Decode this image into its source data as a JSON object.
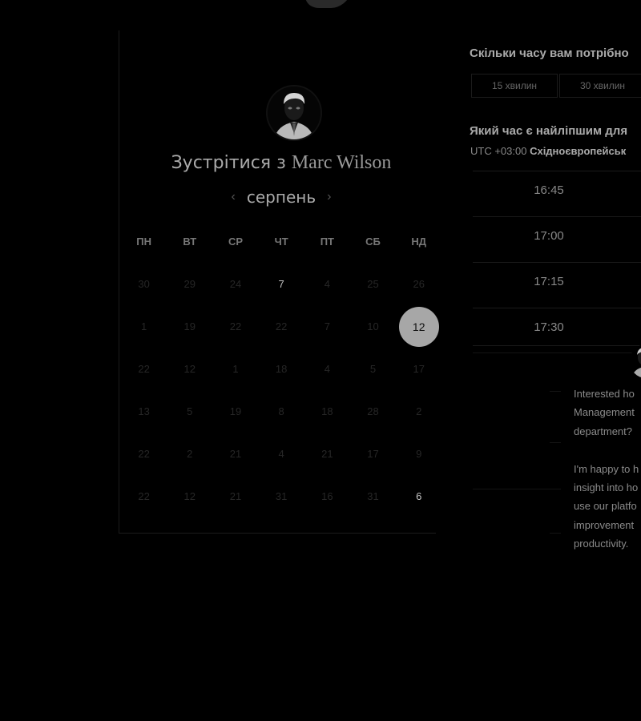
{
  "calendar": {
    "title_prefix": "Зустрітися з",
    "host_name": "Marc Wilson",
    "month": "серпень",
    "prev_arrow": "‹",
    "next_arrow": "›",
    "weekdays": [
      "ПН",
      "ВТ",
      "СР",
      "ЧТ",
      "ПТ",
      "СБ",
      "НД"
    ],
    "days": [
      [
        "30",
        "29",
        "24",
        "7",
        "4",
        "25",
        "26"
      ],
      [
        "1",
        "19",
        "22",
        "22",
        "7",
        "10",
        "12"
      ],
      [
        "22",
        "12",
        "1",
        "18",
        "4",
        "5",
        "17"
      ],
      [
        "13",
        "5",
        "19",
        "8",
        "18",
        "28",
        "2"
      ],
      [
        "22",
        "2",
        "21",
        "4",
        "21",
        "17",
        "9"
      ],
      [
        "22",
        "12",
        "21",
        "31",
        "16",
        "31",
        "6"
      ]
    ],
    "available": [
      [
        0,
        3
      ],
      [
        5,
        6
      ]
    ],
    "selected": [
      1,
      6
    ]
  },
  "panel": {
    "duration_question": "Скільки часу вам потрібно",
    "durations": [
      "15 хвилин",
      "30 хвилин"
    ],
    "time_question": "Який час є найліпшим для",
    "timezone_offset": "UTC +03:00",
    "timezone_name": "Східноєвропейськ",
    "slots": [
      "16:45",
      "17:00",
      "17:15",
      "17:30"
    ]
  },
  "chat": {
    "message": "Interested ho\nManagement\ndepartment?\n\nI'm happy to h\ninsight into ho\nuse our platfo\nimprovement\nproductivity."
  },
  "colors": {
    "background": "#000000",
    "selected_day": "#a7a7a7"
  }
}
